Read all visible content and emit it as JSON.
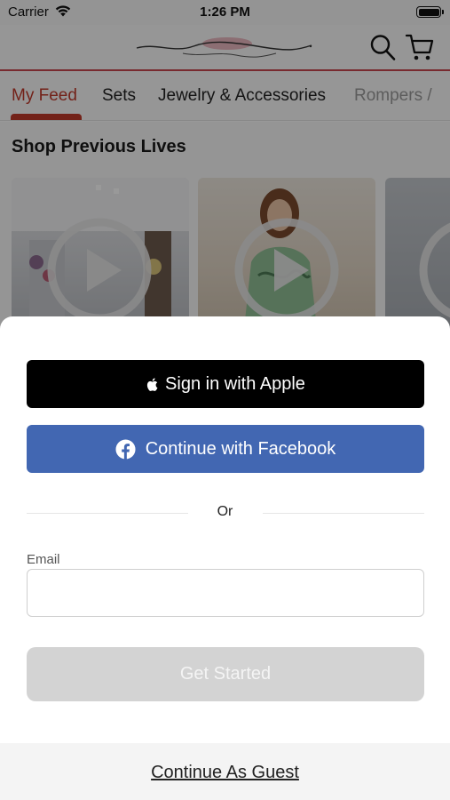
{
  "status_bar": {
    "carrier": "Carrier",
    "time": "1:26 PM",
    "wifi_icon": "wifi-icon",
    "battery_icon": "battery-icon"
  },
  "header": {
    "logo_icon": "brand-logo",
    "search_icon": "search-icon",
    "cart_icon": "shopping-cart-icon",
    "accent_color": "#c9474f"
  },
  "tabs": [
    {
      "label": "My Feed",
      "active": true
    },
    {
      "label": "Sets",
      "active": false
    },
    {
      "label": "Jewelry & Accessories",
      "active": false
    },
    {
      "label": "Rompers /",
      "active": false
    }
  ],
  "feed": {
    "section_title": "Shop Previous Lives",
    "cards": [
      {
        "icon": "play-icon"
      },
      {
        "icon": "play-icon"
      },
      {
        "icon": "play-icon"
      }
    ]
  },
  "sheet": {
    "apple_button": {
      "label": "Sign in with Apple",
      "icon": "apple-logo-icon",
      "color": "#000000"
    },
    "facebook_button": {
      "label": "Continue with Facebook",
      "icon": "facebook-logo-icon",
      "color": "#4267b2"
    },
    "divider_text": "Or",
    "email": {
      "label": "Email",
      "value": "",
      "placeholder": ""
    },
    "get_started_label": "Get Started",
    "guest_label": "Continue As Guest"
  }
}
